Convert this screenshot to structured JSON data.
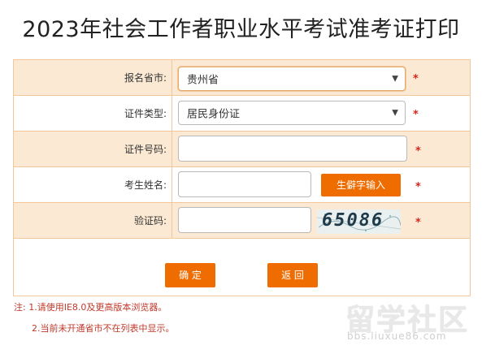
{
  "page": {
    "title": "2023年社会工作者职业水平考试准考证打印"
  },
  "form": {
    "province_label": "报名省市:",
    "province_value": "贵州省",
    "idtype_label": "证件类型:",
    "idtype_value": "居民身份证",
    "idnumber_label": "证件号码:",
    "idnumber_value": "",
    "name_label": "考生姓名:",
    "name_value": "",
    "rare_char_button": "生僻字输入",
    "captcha_label": "验证码:",
    "captcha_value": "",
    "captcha_text": "65086",
    "required_mark": "*"
  },
  "buttons": {
    "confirm": "确 定",
    "back": "返 回"
  },
  "notes": {
    "line1": "注: 1.请使用IE8.0及更高版本浏览器。",
    "line2": "2.当前未开通省市不在列表中显示。"
  },
  "watermark": {
    "main": "留学社区",
    "sub": "bbs.liuxue86.com"
  },
  "icons": {
    "select_chevron": "chevron-down-icon"
  }
}
